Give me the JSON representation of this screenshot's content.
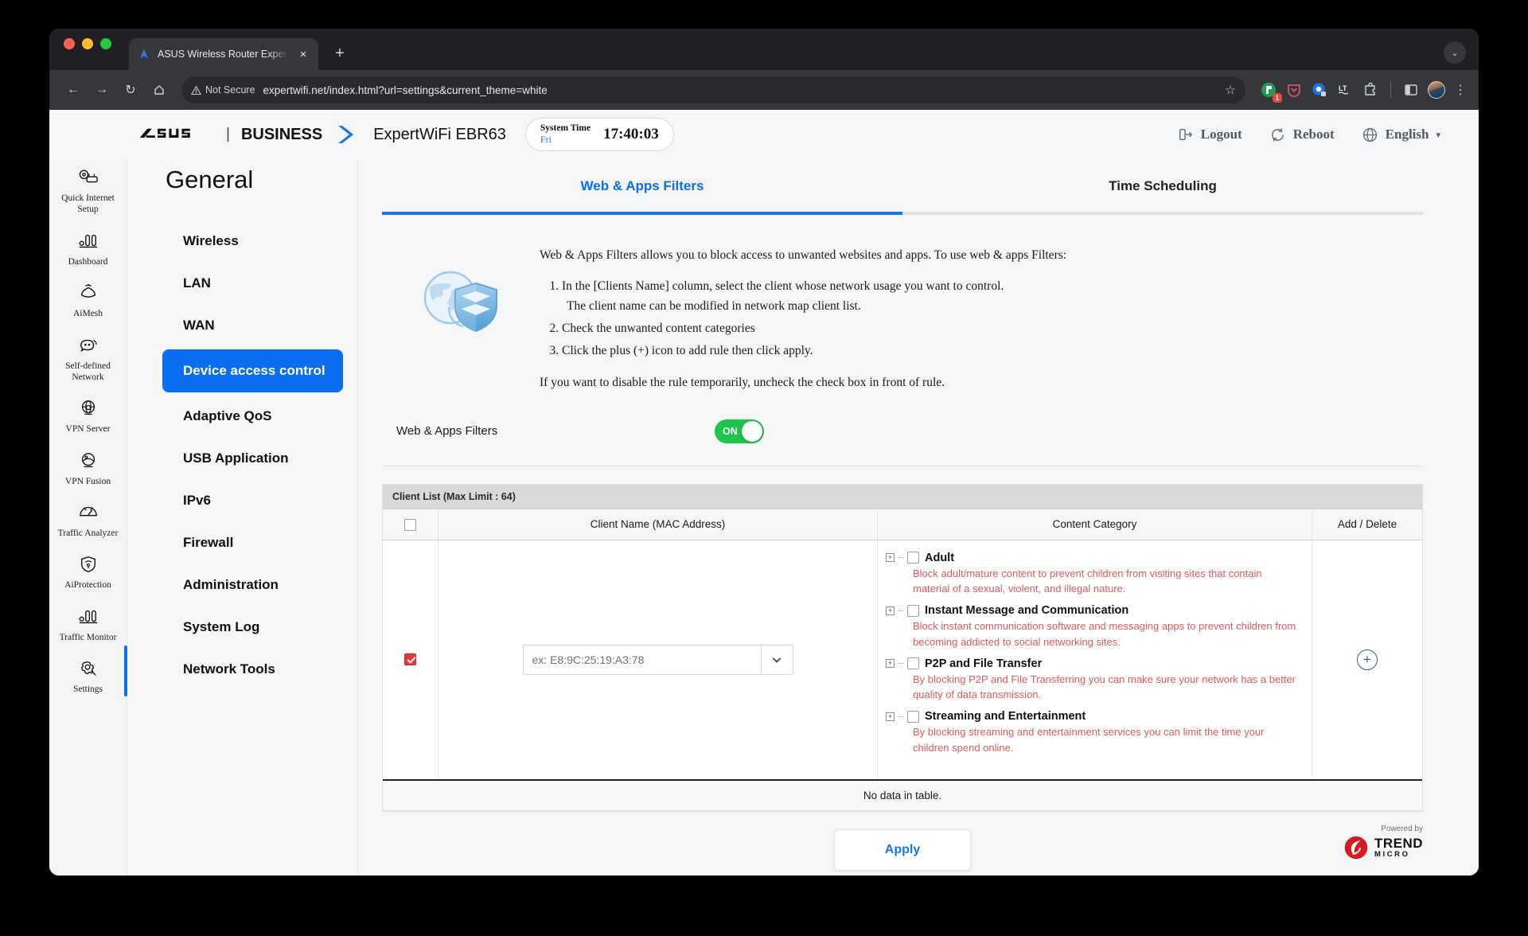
{
  "browser": {
    "tab": {
      "title": "ASUS Wireless Router Exper",
      "close_label": "×",
      "favicon": "asus-router-favicon"
    },
    "new_tab_label": "+",
    "tabstrip_menu_label": "⌄",
    "nav": {
      "back": "←",
      "forward": "→",
      "reload": "↻",
      "home": "⌂"
    },
    "omnibox": {
      "security_label": "Not Secure",
      "url": "expertwifi.net/index.html?url=settings&current_theme=white",
      "bookmark_label": "☆"
    },
    "extensions": [
      {
        "name": "extension-green-badge",
        "badge": "1"
      },
      {
        "name": "pocket-shield-extension",
        "badge": ""
      },
      {
        "name": "privacy-badger-extension",
        "badge": ""
      },
      {
        "name": "language-tool-extension",
        "badge": ""
      },
      {
        "name": "extensions-puzzle-icon",
        "badge": ""
      }
    ],
    "side_panel_label": "side-panel-icon",
    "profile_label": "profile-avatar",
    "menu_label": "⋮"
  },
  "header": {
    "brand": "/ISUS",
    "brand_divider": "|",
    "business": "BUSINESS",
    "model": "ExpertWiFi EBR63",
    "system_time_label": "System Time",
    "system_time_day": "Fri",
    "system_time_value": "17:40:03",
    "logout": "Logout",
    "reboot": "Reboot",
    "language": "English",
    "language_caret": "▾"
  },
  "rail": {
    "items": [
      {
        "icon": "quick-internet-setup-icon",
        "label": "Quick Internet Setup"
      },
      {
        "icon": "dashboard-icon",
        "label": "Dashboard"
      },
      {
        "icon": "aimesh-icon",
        "label": "AiMesh"
      },
      {
        "icon": "self-defined-network-icon",
        "label": "Self-defined Network"
      },
      {
        "icon": "vpn-server-icon",
        "label": "VPN Server"
      },
      {
        "icon": "vpn-fusion-icon",
        "label": "VPN Fusion"
      },
      {
        "icon": "traffic-analyzer-icon",
        "label": "Traffic Analyzer"
      },
      {
        "icon": "aiprotection-icon",
        "label": "AiProtection"
      },
      {
        "icon": "traffic-monitor-icon",
        "label": "Traffic Monitor"
      },
      {
        "icon": "settings-gear-icon",
        "label": "Settings",
        "active": true
      }
    ]
  },
  "menu": {
    "title": "General",
    "items": [
      {
        "label": "Wireless",
        "active": false
      },
      {
        "label": "LAN",
        "active": false
      },
      {
        "label": "WAN",
        "active": false
      },
      {
        "label": "Device access control",
        "active": true
      },
      {
        "label": "Adaptive QoS",
        "active": false
      },
      {
        "label": "USB Application",
        "active": false
      },
      {
        "label": "IPv6",
        "active": false
      },
      {
        "label": "Firewall",
        "active": false
      },
      {
        "label": "Administration",
        "active": false
      },
      {
        "label": "System Log",
        "active": false
      },
      {
        "label": "Network Tools",
        "active": false
      }
    ]
  },
  "main": {
    "tabs": [
      {
        "label": "Web & Apps Filters",
        "active": true
      },
      {
        "label": "Time Scheduling",
        "active": false
      }
    ],
    "intro": {
      "lead": "Web & Apps Filters allows you to block access to unwanted websites and apps. To use web & apps Filters:",
      "step1": "In the [Clients Name] column, select the client whose network usage you want to control.",
      "step1_sub": "The client name can be modified in network map client list.",
      "step2": "Check the unwanted content categories",
      "step3": "Click the plus (+) icon to add rule then click apply.",
      "closing": "If you want to disable the rule temporarily, uncheck the check box in front of rule."
    },
    "filter_toggle": {
      "label": "Web & Apps Filters",
      "state": "ON",
      "color": "#1fc44b"
    },
    "table": {
      "caption": "Client List (Max Limit : 64)",
      "headers": {
        "select_all": "",
        "client_name": "Client Name (MAC Address)",
        "content_category": "Content Category",
        "add_delete": "Add / Delete"
      },
      "row": {
        "enabled": true,
        "mac_placeholder": "ex: E8:9C:25:19:A3:78",
        "mac_value": "",
        "dropdown_caret": "∨",
        "add_label": "+"
      },
      "categories": [
        {
          "name": "Adult",
          "checked": false,
          "description": "Block adult/mature content to prevent children from visiting sites that contain material of a sexual, violent, and illegal nature."
        },
        {
          "name": "Instant Message and Communication",
          "checked": false,
          "description": "Block instant communication software and messaging apps to prevent children from becoming addicted to social networking sites."
        },
        {
          "name": "P2P and File Transfer",
          "checked": false,
          "description": "By blocking P2P and File Transferring you can make sure your network has a better quality of data transmission."
        },
        {
          "name": "Streaming and Entertainment",
          "checked": false,
          "description": "By blocking streaming and entertainment services you can limit the time your children spend online."
        }
      ],
      "empty_message": "No data in table."
    },
    "apply_label": "Apply",
    "powered_by_label": "Powered by",
    "trend_word": "TREND",
    "micro_word": "MICRO"
  },
  "colors": {
    "accent_blue": "#0b6ef0",
    "toggle_green": "#1fc44b",
    "category_red": "#e05a5a",
    "checkbox_red": "#e03a3a"
  }
}
